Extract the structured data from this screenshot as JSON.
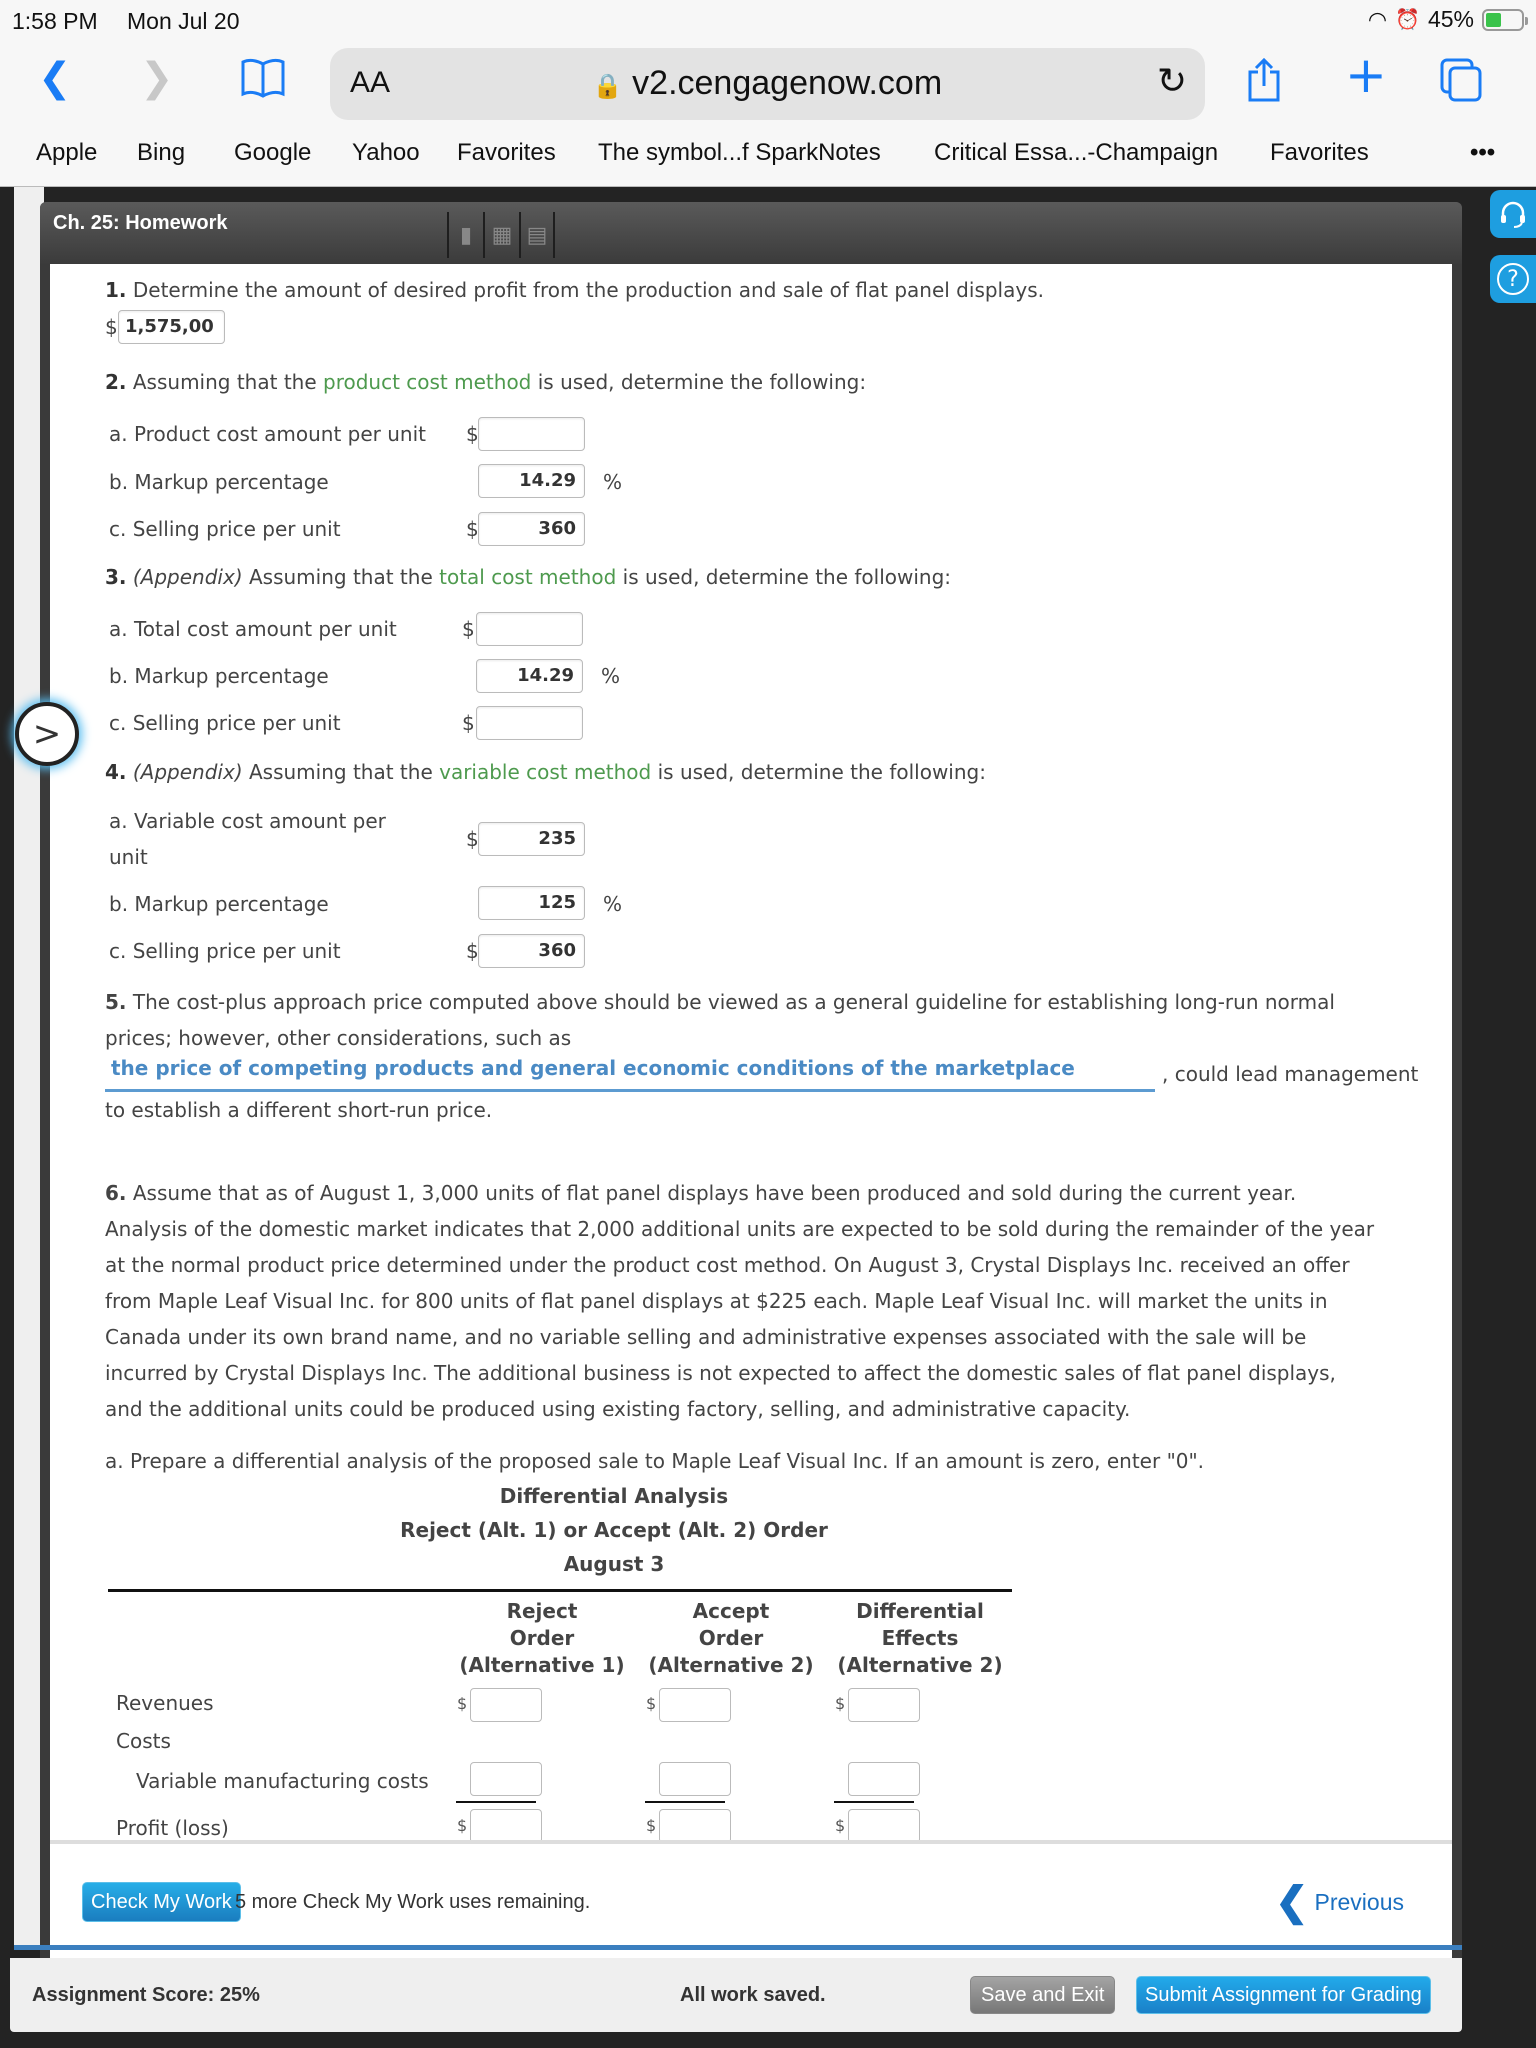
{
  "status_bar": {
    "time": "1:58 PM",
    "date": "Mon Jul 20",
    "battery": "45%",
    "battery_level": 0.45
  },
  "browser": {
    "text_size_label": "AA",
    "url": "v2.cengagenow.com",
    "favorites": [
      "Apple",
      "Bing",
      "Google",
      "Yahoo",
      "Favorites",
      "The symbol...f SparkNotes",
      "Critical Essa...-Champaign",
      "Favorites"
    ],
    "more_label": "•••"
  },
  "panel": {
    "title": "Ch. 25: Homework"
  },
  "q1": {
    "num": "1.",
    "text": "Determine the amount of desired profit from the production and sale of flat panel displays.",
    "currency": "$",
    "value": "1,575,00"
  },
  "q2": {
    "num": "2.",
    "pre": "Assuming that the ",
    "link": "product cost method",
    "post": " is used, determine the following:",
    "items": [
      {
        "label": "a.  Product cost amount per unit",
        "prefix": "$",
        "value": "",
        "suffix": ""
      },
      {
        "label": "b.  Markup percentage",
        "prefix": "",
        "value": "14.29",
        "suffix": "%"
      },
      {
        "label": "c.  Selling price per unit",
        "prefix": "$",
        "value": "360",
        "suffix": ""
      }
    ]
  },
  "q3": {
    "num": "3.",
    "appendix": "(Appendix)",
    "pre": " Assuming that the ",
    "link": "total cost method",
    "post": " is used, determine the following:",
    "items": [
      {
        "label": "a.  Total cost amount per unit",
        "prefix": "$",
        "value": "",
        "suffix": ""
      },
      {
        "label": "b.  Markup percentage",
        "prefix": "",
        "value": "14.29",
        "suffix": "%"
      },
      {
        "label": "c.  Selling price per unit",
        "prefix": "$",
        "value": "",
        "suffix": ""
      }
    ]
  },
  "q4": {
    "num": "4.",
    "appendix": "(Appendix)",
    "pre": " Assuming that the ",
    "link": "variable cost method",
    "post": " is used, determine the following:",
    "items": [
      {
        "label": "a.  Variable cost amount per",
        "label2": "unit",
        "prefix": "$",
        "value": "235",
        "suffix": ""
      },
      {
        "label": "b.  Markup percentage",
        "prefix": "",
        "value": "125",
        "suffix": "%"
      },
      {
        "label": "c.  Selling price per unit",
        "prefix": "$",
        "value": "360",
        "suffix": ""
      }
    ]
  },
  "q5": {
    "num": "5.",
    "line1": "The cost-plus approach price computed above should be viewed as a general guideline for establishing long-run normal",
    "line2": "prices; however, other considerations, such as",
    "answer": "the price of competing products and general economic conditions of the marketplace",
    "after": ", could lead management",
    "line4": "to establish a different short-run price."
  },
  "q6": {
    "num": "6.",
    "lines": [
      "Assume that as of August 1, 3,000 units of flat panel displays have been produced and sold during the current year.",
      "Analysis of the domestic market indicates that 2,000 additional units are expected to be sold during the remainder of the year",
      "at the normal product price determined under the product cost method. On August 3, Crystal Displays Inc. received an offer",
      "from Maple Leaf Visual Inc. for 800 units of flat panel displays at $225 each. Maple Leaf Visual Inc. will market the units in",
      "Canada under its own brand name, and no variable selling and administrative expenses associated with the sale will be",
      "incurred by Crystal Displays Inc. The additional business is not expected to affect the domestic sales of flat panel displays,",
      "and the additional units could be produced using existing factory, selling, and administrative capacity."
    ],
    "part_a": "a.  Prepare a differential analysis of the proposed sale to Maple Leaf Visual Inc. If an amount is zero, enter \"0\"."
  },
  "analysis_table": {
    "title1": "Differential Analysis",
    "title2": "Reject (Alt. 1) or Accept (Alt. 2) Order",
    "title3": "August 3",
    "columns": [
      {
        "l1": "Reject",
        "l2": "Order",
        "l3": "(Alternative 1)"
      },
      {
        "l1": "Accept",
        "l2": "Order",
        "l3": "(Alternative 2)"
      },
      {
        "l1": "Differential",
        "l2": "Effects",
        "l3": "(Alternative 2)"
      }
    ],
    "rows": [
      {
        "label": "Revenues",
        "values": [
          "",
          "",
          ""
        ],
        "currency": "$"
      },
      {
        "label": "Costs"
      },
      {
        "label": "Variable manufacturing costs",
        "values": [
          "",
          "",
          ""
        ]
      },
      {
        "label": "Profit (loss)",
        "values": [
          "",
          "",
          ""
        ],
        "currency": "$"
      }
    ]
  },
  "footer": {
    "check_label": "Check My Work",
    "check_note": "5 more Check My Work uses remaining.",
    "previous_label": "Previous"
  },
  "bottom": {
    "score": "Assignment Score: 25%",
    "saved": "All work saved.",
    "save_exit": "Save and Exit",
    "submit": "Submit Assignment for Grading"
  }
}
